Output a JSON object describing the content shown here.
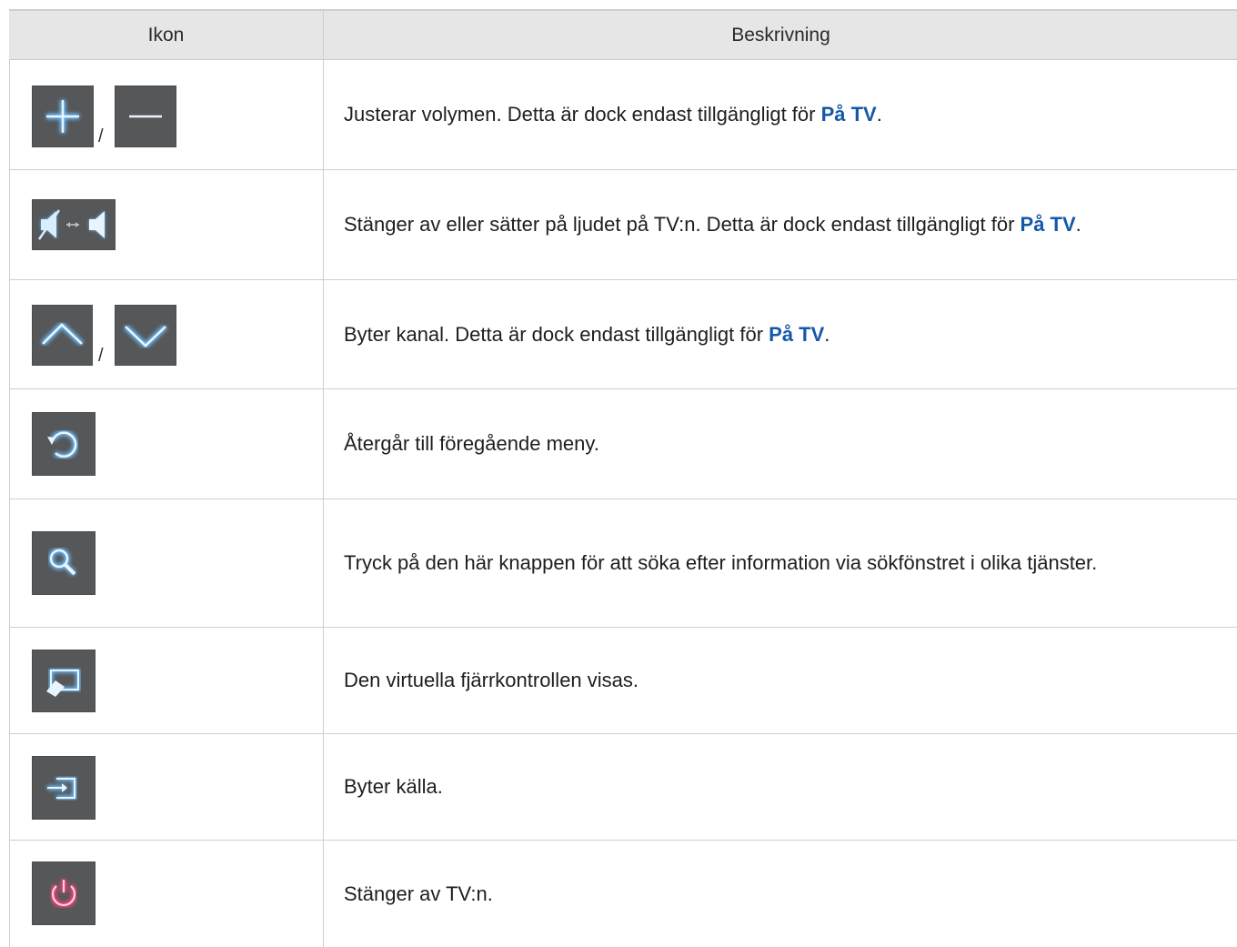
{
  "header": {
    "col_icon": "Ikon",
    "col_desc": "Beskrivning"
  },
  "rows": [
    {
      "icon": "plus-minus-icon",
      "separator": "/",
      "desc_pre": "Justerar volymen. Detta är dock endast tillgängligt för ",
      "desc_hl": "På TV",
      "desc_post": "."
    },
    {
      "icon": "mute-toggle-icon",
      "desc_pre": "Stänger av eller sätter på ljudet på TV:n. Detta är dock endast tillgängligt för ",
      "desc_hl": "På TV",
      "desc_post": "."
    },
    {
      "icon": "channel-up-down-icon",
      "separator": "/",
      "desc_pre": "Byter kanal. Detta är dock endast tillgängligt för ",
      "desc_hl": "På TV",
      "desc_post": "."
    },
    {
      "icon": "return-icon",
      "desc": "Återgår till föregående meny."
    },
    {
      "icon": "search-icon",
      "desc": "Tryck på den här knappen för att söka efter information via sökfönstret i olika tjänster."
    },
    {
      "icon": "virtual-remote-icon",
      "desc": "Den virtuella fjärrkontrollen visas."
    },
    {
      "icon": "source-icon",
      "desc": "Byter källa."
    },
    {
      "icon": "power-icon",
      "desc": "Stänger av TV:n."
    }
  ],
  "colors": {
    "accent": "#1458a8",
    "icon_glow": "#4aa8ff",
    "power": "#e0306a",
    "button_bg": "#555759"
  }
}
